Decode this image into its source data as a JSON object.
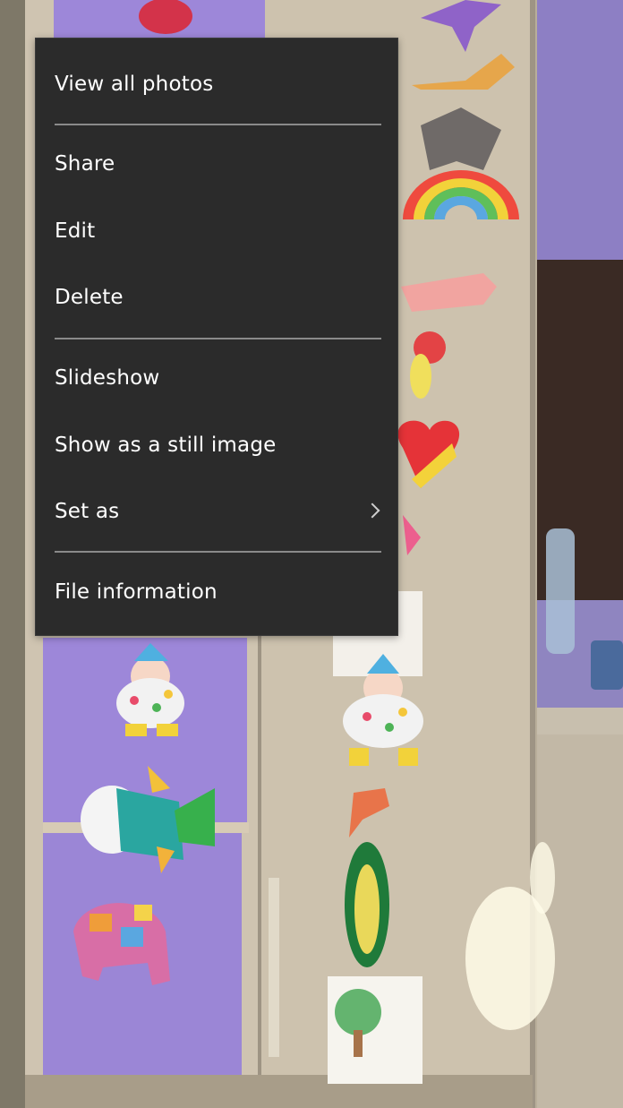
{
  "context_menu": {
    "items": [
      {
        "label": "View all photos"
      },
      {
        "label": "Share"
      },
      {
        "label": "Edit"
      },
      {
        "label": "Delete"
      },
      {
        "label": "Slideshow"
      },
      {
        "label": "Show as a still image"
      },
      {
        "label": "Set as",
        "icon": "chevron-right-icon"
      },
      {
        "label": "File information"
      }
    ]
  },
  "colors": {
    "menu_background": "#2b2b2b",
    "menu_text": "#ffffff",
    "separator": "#8a8a8a",
    "board_purple": "#9d87d9",
    "cabinet_wood": "#c9bfae"
  }
}
